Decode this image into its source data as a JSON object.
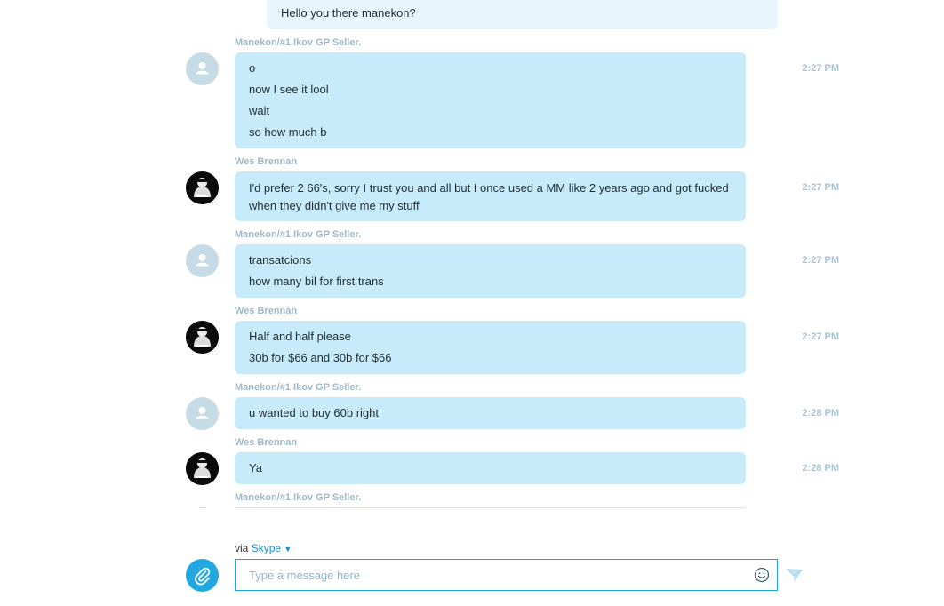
{
  "conversation": {
    "own_partial": {
      "text": "Hello you there manekon?"
    },
    "messages": [
      {
        "sender": "Manekon/#1 Ikov GP Seller.",
        "avatar": "default-user-icon",
        "time": "2:27 PM",
        "lines": [
          "o",
          "now I see it lool",
          "wait",
          "so how much b"
        ]
      },
      {
        "sender": "Wes Brennan",
        "avatar": "profile-photo",
        "time": "2:27 PM",
        "lines": [
          "I'd prefer 2 66's, sorry I trust you and all but I once used a MM like 2 years ago and got fucked when they didn't give me my stuff"
        ]
      },
      {
        "sender": "Manekon/#1 Ikov GP Seller.",
        "avatar": "default-user-icon",
        "time": "2:27 PM",
        "lines": [
          "transatcions",
          "how many bil for first trans"
        ]
      },
      {
        "sender": "Wes Brennan",
        "avatar": "profile-photo",
        "time": "2:27 PM",
        "lines": [
          "Half and half please",
          "30b for $66 and 30b for $66"
        ]
      },
      {
        "sender": "Manekon/#1 Ikov GP Seller.",
        "avatar": "default-user-icon",
        "time": "2:28 PM",
        "lines": [
          "u wanted to buy 60b right"
        ]
      },
      {
        "sender": "Wes Brennan",
        "avatar": "profile-photo",
        "time": "2:28 PM",
        "lines": [
          "Ya"
        ]
      },
      {
        "sender": "Manekon/#1 Ikov GP Seller.",
        "avatar": "default-user-icon",
        "time": "",
        "lines": []
      }
    ]
  },
  "composer": {
    "via_label": "via",
    "via_service": "Skype",
    "placeholder": "Type a message here",
    "value": "",
    "attach_icon": "paperclip-icon",
    "emoji_icon": "smiley-icon",
    "send_icon": "paper-plane-icon"
  },
  "colors": {
    "incoming_bubble": "#c7ebfb",
    "own_bubble": "#e8f5fd",
    "sender_name": "#9fb9c6",
    "accent": "#21a8e0"
  }
}
